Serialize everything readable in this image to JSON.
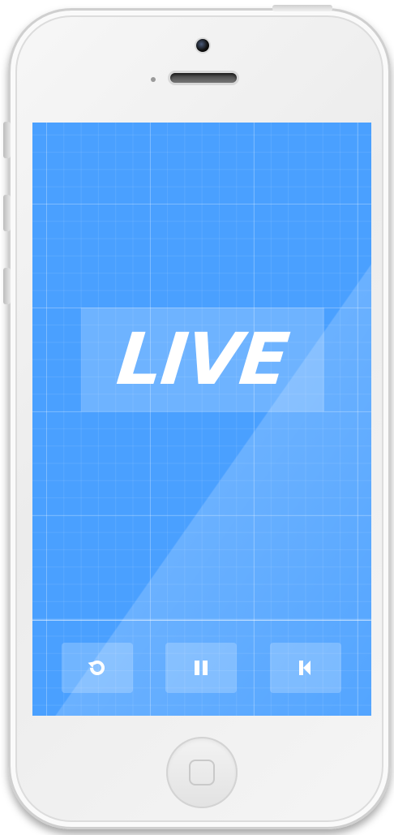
{
  "screen": {
    "title_text": "LIVE",
    "background_color": "#4aa0ff"
  },
  "controls": [
    {
      "name": "replay",
      "icon": "replay-icon"
    },
    {
      "name": "pause",
      "icon": "pause-icon"
    },
    {
      "name": "previous",
      "icon": "previous-icon"
    }
  ],
  "device": {
    "home_button_icon": "home-square-icon"
  }
}
